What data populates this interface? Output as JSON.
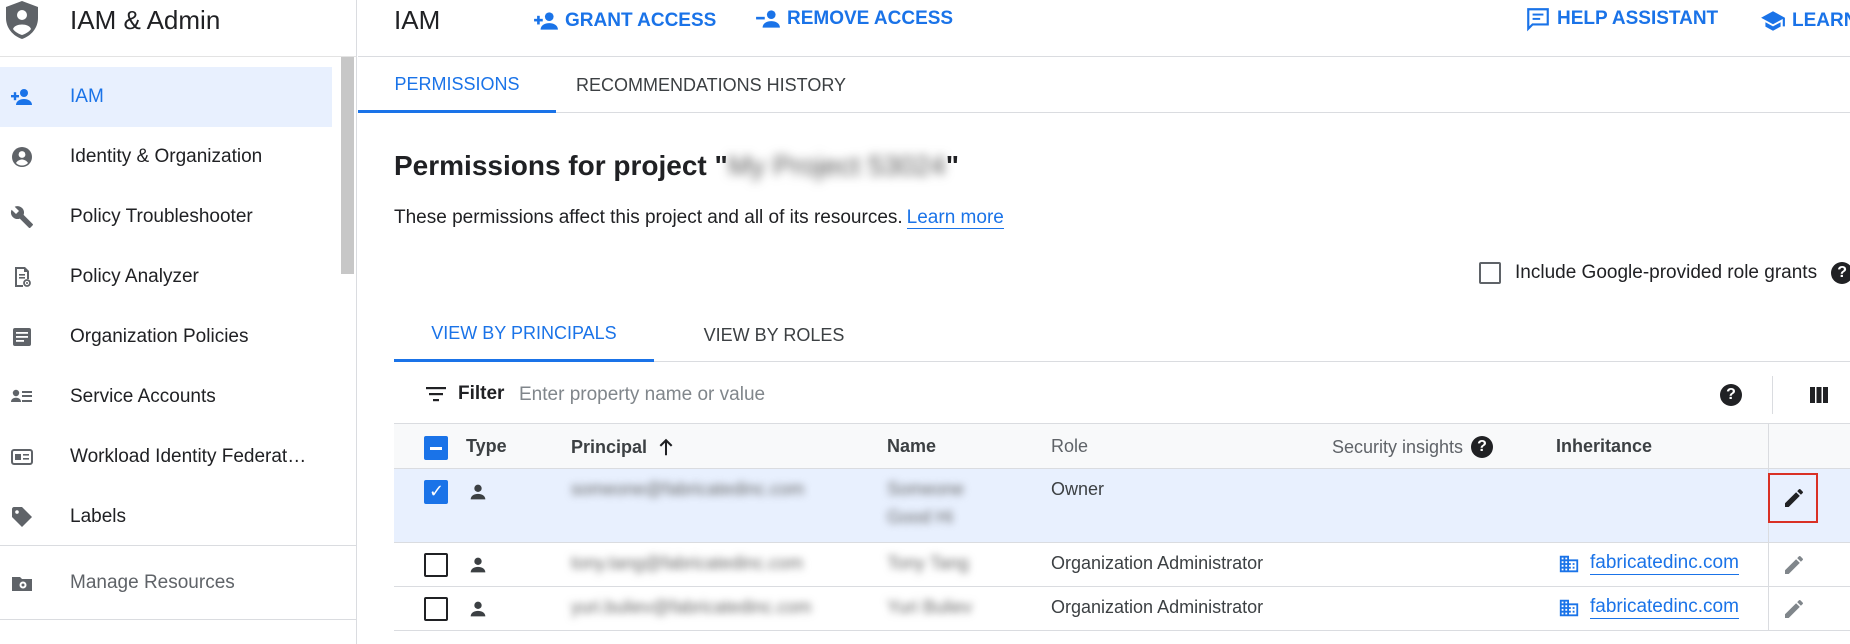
{
  "sidebar": {
    "title": "IAM & Admin",
    "items": [
      {
        "label": "IAM",
        "icon": "person-add-icon"
      },
      {
        "label": "Identity & Organization",
        "icon": "account-circle-icon"
      },
      {
        "label": "Policy Troubleshooter",
        "icon": "wrench-icon"
      },
      {
        "label": "Policy Analyzer",
        "icon": "policy-analyzer-icon"
      },
      {
        "label": "Organization Policies",
        "icon": "list-document-icon"
      },
      {
        "label": "Service Accounts",
        "icon": "service-account-icon"
      },
      {
        "label": "Workload Identity Federat…",
        "icon": "id-card-icon"
      },
      {
        "label": "Labels",
        "icon": "label-tag-icon"
      }
    ],
    "manage_resources": "Manage Resources"
  },
  "topbar": {
    "title": "IAM",
    "grant_access": "GRANT ACCESS",
    "remove_access": "REMOVE ACCESS",
    "help_assistant": "HELP ASSISTANT",
    "learn": "LEARN"
  },
  "tabs": {
    "permissions": "PERMISSIONS",
    "recommendations_history": "RECOMMENDATIONS HISTORY"
  },
  "page": {
    "heading_prefix": "Permissions for project \"",
    "project_name": "My Project 53024",
    "heading_suffix": "\"",
    "description": "These permissions affect this project and all of its resources.",
    "learn_more": "Learn more",
    "include_grants_label": "Include Google-provided role grants"
  },
  "view_tabs": {
    "by_principals": "VIEW BY PRINCIPALS",
    "by_roles": "VIEW BY ROLES"
  },
  "filter": {
    "label": "Filter",
    "placeholder": "Enter property name or value"
  },
  "table": {
    "columns": {
      "type": "Type",
      "principal": "Principal",
      "name": "Name",
      "role": "Role",
      "security_insights": "Security insights",
      "inheritance": "Inheritance"
    },
    "rows": [
      {
        "principal": "someone@fabricatedinc.com",
        "name_line1": "Someone",
        "name_line2": "Good Hi",
        "role": "Owner",
        "inheritance": "",
        "selected": true
      },
      {
        "principal": "tony.tang@fabricatedinc.com",
        "name_line1": "Tony Tang",
        "name_line2": "",
        "role": "Organization Administrator",
        "inheritance": "fabricatedinc.com",
        "selected": false
      },
      {
        "principal": "yuri.buliev@fabricatedinc.com",
        "name_line1": "Yuri Buliev",
        "name_line2": "",
        "role": "Organization Administrator",
        "inheritance": "fabricatedinc.com",
        "selected": false
      }
    ]
  },
  "colors": {
    "accent": "#1a73e8",
    "selected_row": "#e8f0fe",
    "focus_outline": "#d93025"
  }
}
